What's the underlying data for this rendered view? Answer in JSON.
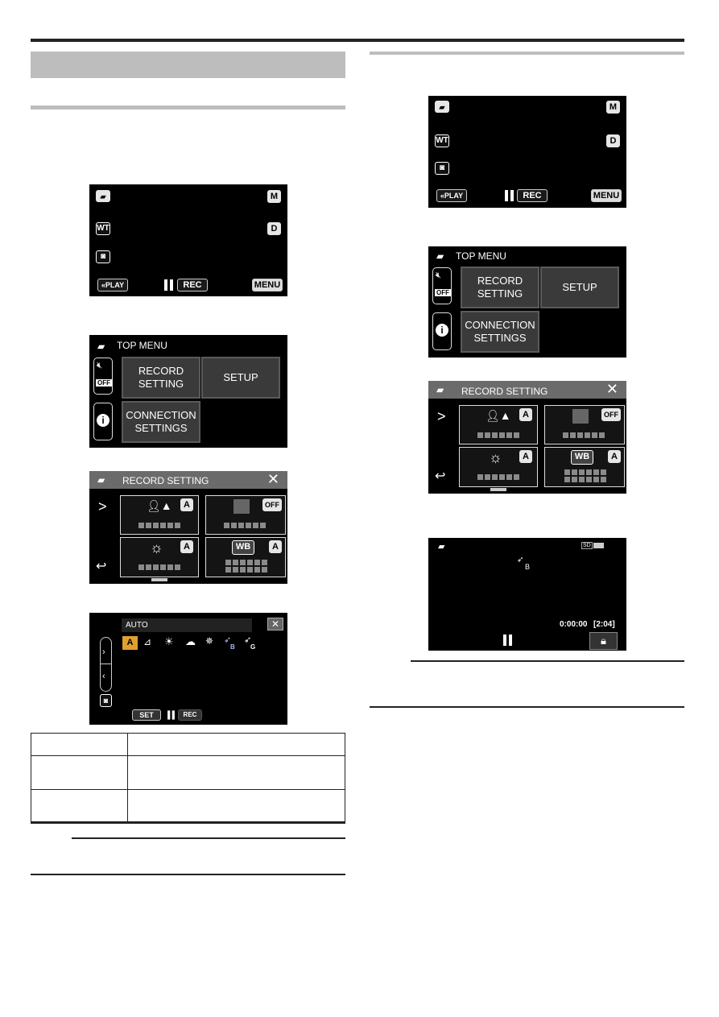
{
  "page": {
    "left_column": {
      "screen1": {
        "icons": [
          "video-mode-icon",
          "wt-icon",
          "camera-icon"
        ],
        "badges": {
          "m": "M",
          "d": "D",
          "wt": "WT"
        },
        "buttons": {
          "play": "«PLAY",
          "rec": "REC",
          "menu": "MENU"
        }
      },
      "screen2": {
        "title": "TOP MENU",
        "tiles": {
          "record": "RECORD\nSETTING",
          "setup": "SETUP",
          "connection": "CONNECTION\nSETTINGS"
        },
        "off_badge": "OFF"
      },
      "screen3": {
        "title": "RECORD SETTING",
        "badges": {
          "a": "A",
          "off": "OFF",
          "wb": "WB"
        },
        "nav": {
          "next": ">",
          "back": "↩"
        }
      },
      "screen4": {
        "selected_label": "AUTO",
        "options": [
          "A",
          "FLUORESCENT",
          "SUNSHINE",
          "CLOUD",
          "HALOGEN",
          "MARINE:BLUE",
          "MARINE:GREEN"
        ],
        "marine_b": "B",
        "marine_g": "G",
        "set_button": "SET",
        "rec_button": "REC"
      },
      "table": {
        "rows": [
          [
            "",
            ""
          ],
          [
            "",
            ""
          ],
          [
            "",
            ""
          ]
        ]
      }
    },
    "right_column": {
      "screen1": {
        "badges": {
          "m": "M",
          "d": "D",
          "wt": "WT"
        },
        "buttons": {
          "play": "«PLAY",
          "rec": "REC",
          "menu": "MENU"
        }
      },
      "screen2": {
        "title": "TOP MENU",
        "tiles": {
          "record": "RECORD\nSETTING",
          "setup": "SETUP",
          "connection": "CONNECTION\nSETTINGS"
        },
        "off_badge": "OFF"
      },
      "screen3": {
        "title": "RECORD SETTING",
        "badges": {
          "a": "A",
          "off": "OFF",
          "wb": "WB"
        },
        "nav": {
          "next": ">",
          "back": "↩"
        }
      },
      "screen4": {
        "wb_indicator": "B",
        "media": "SD",
        "time_elapsed": "0:00:00",
        "time_remaining": "[2:04]"
      }
    }
  }
}
